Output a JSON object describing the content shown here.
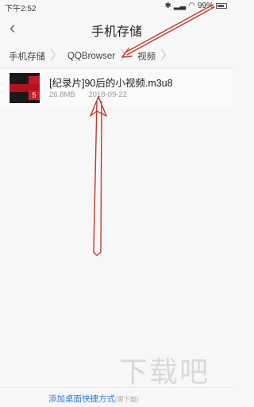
{
  "status_bar": {
    "time": "下午2:52",
    "battery": "99%"
  },
  "header": {
    "title": "手机存储",
    "back_icon": "chevron-left-icon"
  },
  "breadcrumb": [
    "手机存储",
    "QQBrowser",
    "视频"
  ],
  "files": [
    {
      "name": "[纪录片]90后的小视频.m3u8",
      "size": "26.8MB",
      "date": "2018-09-22",
      "thumb_text": "5"
    }
  ],
  "bottom": {
    "link": "添加桌面快捷方式",
    "hint": "(需下载)"
  },
  "watermark": "下载吧",
  "colors": {
    "link": "#2c7be5",
    "annotation": "#c0392b"
  }
}
